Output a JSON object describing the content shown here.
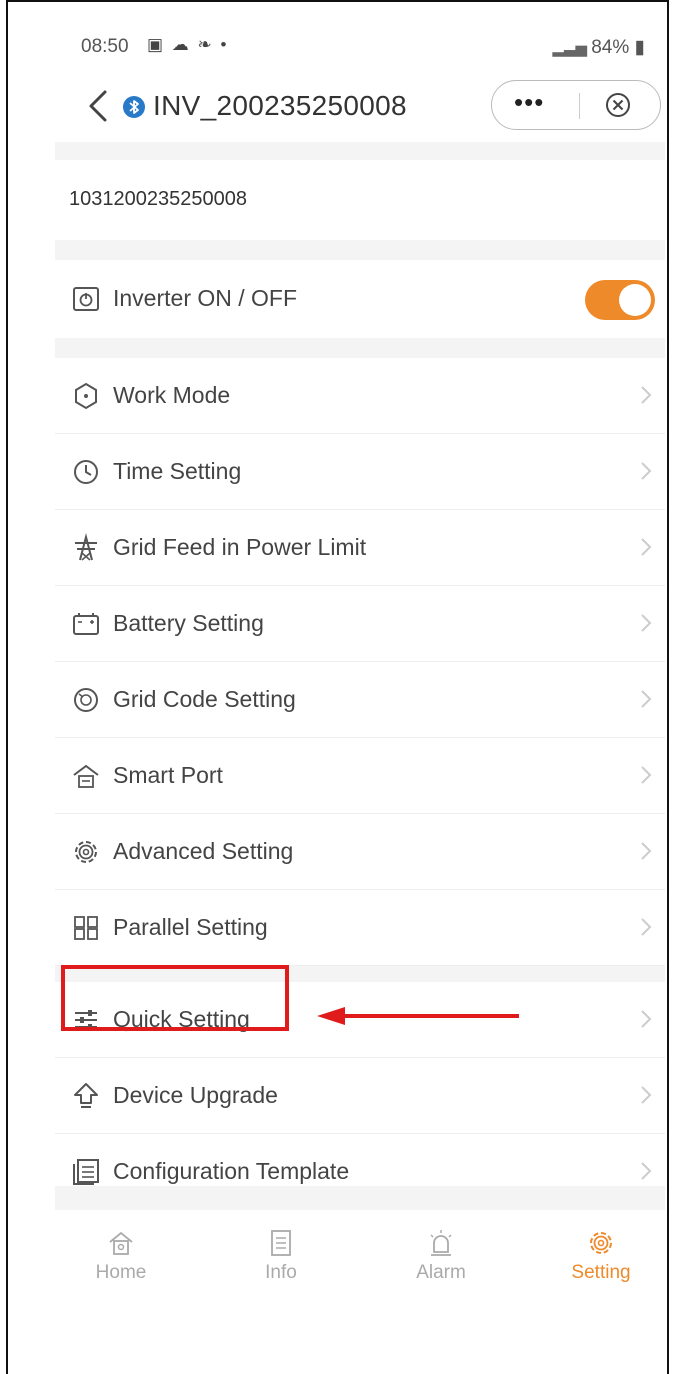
{
  "status_bar": {
    "time": "08:50",
    "icons": "▣ ☁ ❧ •",
    "signal": "84%"
  },
  "nav": {
    "title": "INV_200235250008",
    "more_label": "•••",
    "back_icon": "chevron-left-icon",
    "bluetooth_icon": "bluetooth-icon",
    "close_icon": "close-circle-icon"
  },
  "device": {
    "serial": "1031200235250008"
  },
  "toggle_row": {
    "label": "Inverter ON / OFF",
    "icon": "power-box-icon",
    "on": true
  },
  "menu": [
    {
      "label": "Work Mode",
      "icon": "work-mode-icon"
    },
    {
      "label": "Time Setting",
      "icon": "clock-icon"
    },
    {
      "label": "Grid Feed in Power Limit",
      "icon": "power-tower-icon"
    },
    {
      "label": "Battery Setting",
      "icon": "battery-icon"
    },
    {
      "label": "Grid Code Setting",
      "icon": "grid-code-icon"
    },
    {
      "label": "Smart Port",
      "icon": "smart-port-icon"
    },
    {
      "label": "Advanced Setting",
      "icon": "gear-icon"
    },
    {
      "label": "Parallel Setting",
      "icon": "parallel-icon"
    }
  ],
  "menu2": [
    {
      "label": "Quick Setting",
      "icon": "sliders-icon"
    },
    {
      "label": "Device Upgrade",
      "icon": "upgrade-icon"
    },
    {
      "label": "Configuration Template",
      "icon": "template-icon"
    }
  ],
  "tabs": [
    {
      "label": "Home",
      "icon": "home-icon"
    },
    {
      "label": "Info",
      "icon": "info-doc-icon"
    },
    {
      "label": "Alarm",
      "icon": "alarm-icon"
    },
    {
      "label": "Setting",
      "icon": "gear-icon"
    }
  ],
  "colors": {
    "accent": "#ef8a2b",
    "highlight": "#e01b1b",
    "bluetooth": "#2979c9"
  }
}
